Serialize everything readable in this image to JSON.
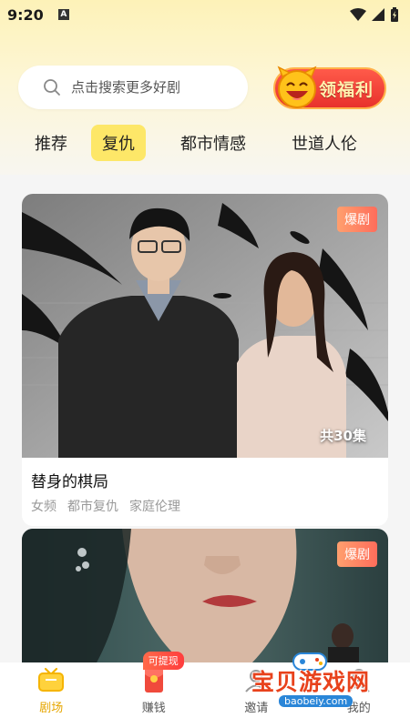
{
  "status_bar": {
    "time": "9:20",
    "notification_letter": "A"
  },
  "search": {
    "placeholder": "点击搜索更多好剧"
  },
  "welfare_button": {
    "label": "领福利"
  },
  "tabs": [
    {
      "label": "推荐",
      "active": false
    },
    {
      "label": "复仇",
      "active": true
    },
    {
      "label": "都市情感",
      "active": false
    },
    {
      "label": "世道人伦",
      "active": false
    }
  ],
  "dramas": [
    {
      "badge": "爆剧",
      "episodes": "共30集",
      "title": "替身的棋局",
      "tags": [
        "女频",
        "都市复仇",
        "家庭伦理"
      ]
    },
    {
      "badge": "爆剧"
    }
  ],
  "bottom_nav": [
    {
      "label": "剧场",
      "icon": "tv-icon",
      "active": true
    },
    {
      "label": "赚钱",
      "icon": "red-envelope-icon",
      "badge": "可提现"
    },
    {
      "label": "邀请",
      "icon": "invite-icon"
    },
    {
      "label": "我的",
      "icon": "profile-icon"
    }
  ],
  "watermark": {
    "text": "宝贝游戏网",
    "url": "baobeiy.com"
  },
  "colors": {
    "accent": "#fde768",
    "active_nav": "#e6a600",
    "badge": "#ff6d5b"
  }
}
